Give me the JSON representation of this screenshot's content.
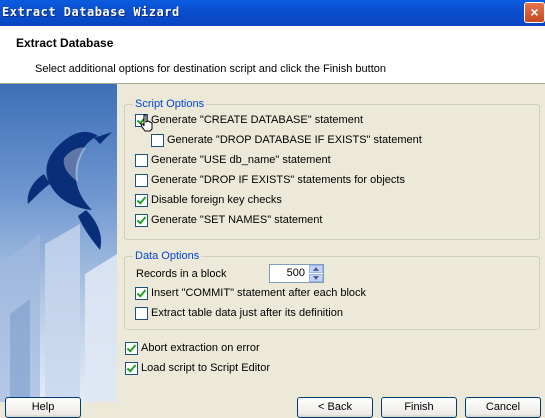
{
  "window": {
    "title": "Extract Database Wizard"
  },
  "header": {
    "title": "Extract Database",
    "subtitle": "Select additional options for destination script and click the Finish button"
  },
  "script_options": {
    "label": "Script Options",
    "items": [
      {
        "label": "Generate \"CREATE DATABASE\" statement",
        "checked": true
      },
      {
        "label": "Generate \"DROP DATABASE IF EXISTS\" statement",
        "checked": false
      },
      {
        "label": "Generate \"USE db_name\" statement",
        "checked": false
      },
      {
        "label": "Generate \"DROP IF EXISTS\" statements for objects",
        "checked": false
      },
      {
        "label": "Disable foreign key checks",
        "checked": true
      },
      {
        "label": "Generate \"SET NAMES\" statement",
        "checked": true
      }
    ]
  },
  "data_options": {
    "label": "Data Options",
    "records_label": "Records in a block",
    "records_value": "500",
    "items": [
      {
        "label": "Insert \"COMMIT\" statement after each block",
        "checked": true
      },
      {
        "label": "Extract table data just after its definition",
        "checked": false
      }
    ]
  },
  "extra_options": [
    {
      "label": "Abort extraction on error",
      "checked": true
    },
    {
      "label": "Load script to Script Editor",
      "checked": true
    }
  ],
  "buttons": {
    "help": "Help",
    "back": "< Back",
    "finish": "Finish",
    "cancel": "Cancel"
  },
  "colors": {
    "group_label": "#0046d5",
    "titlebar": "#0b4fd0",
    "checkmark": "#21a121"
  }
}
